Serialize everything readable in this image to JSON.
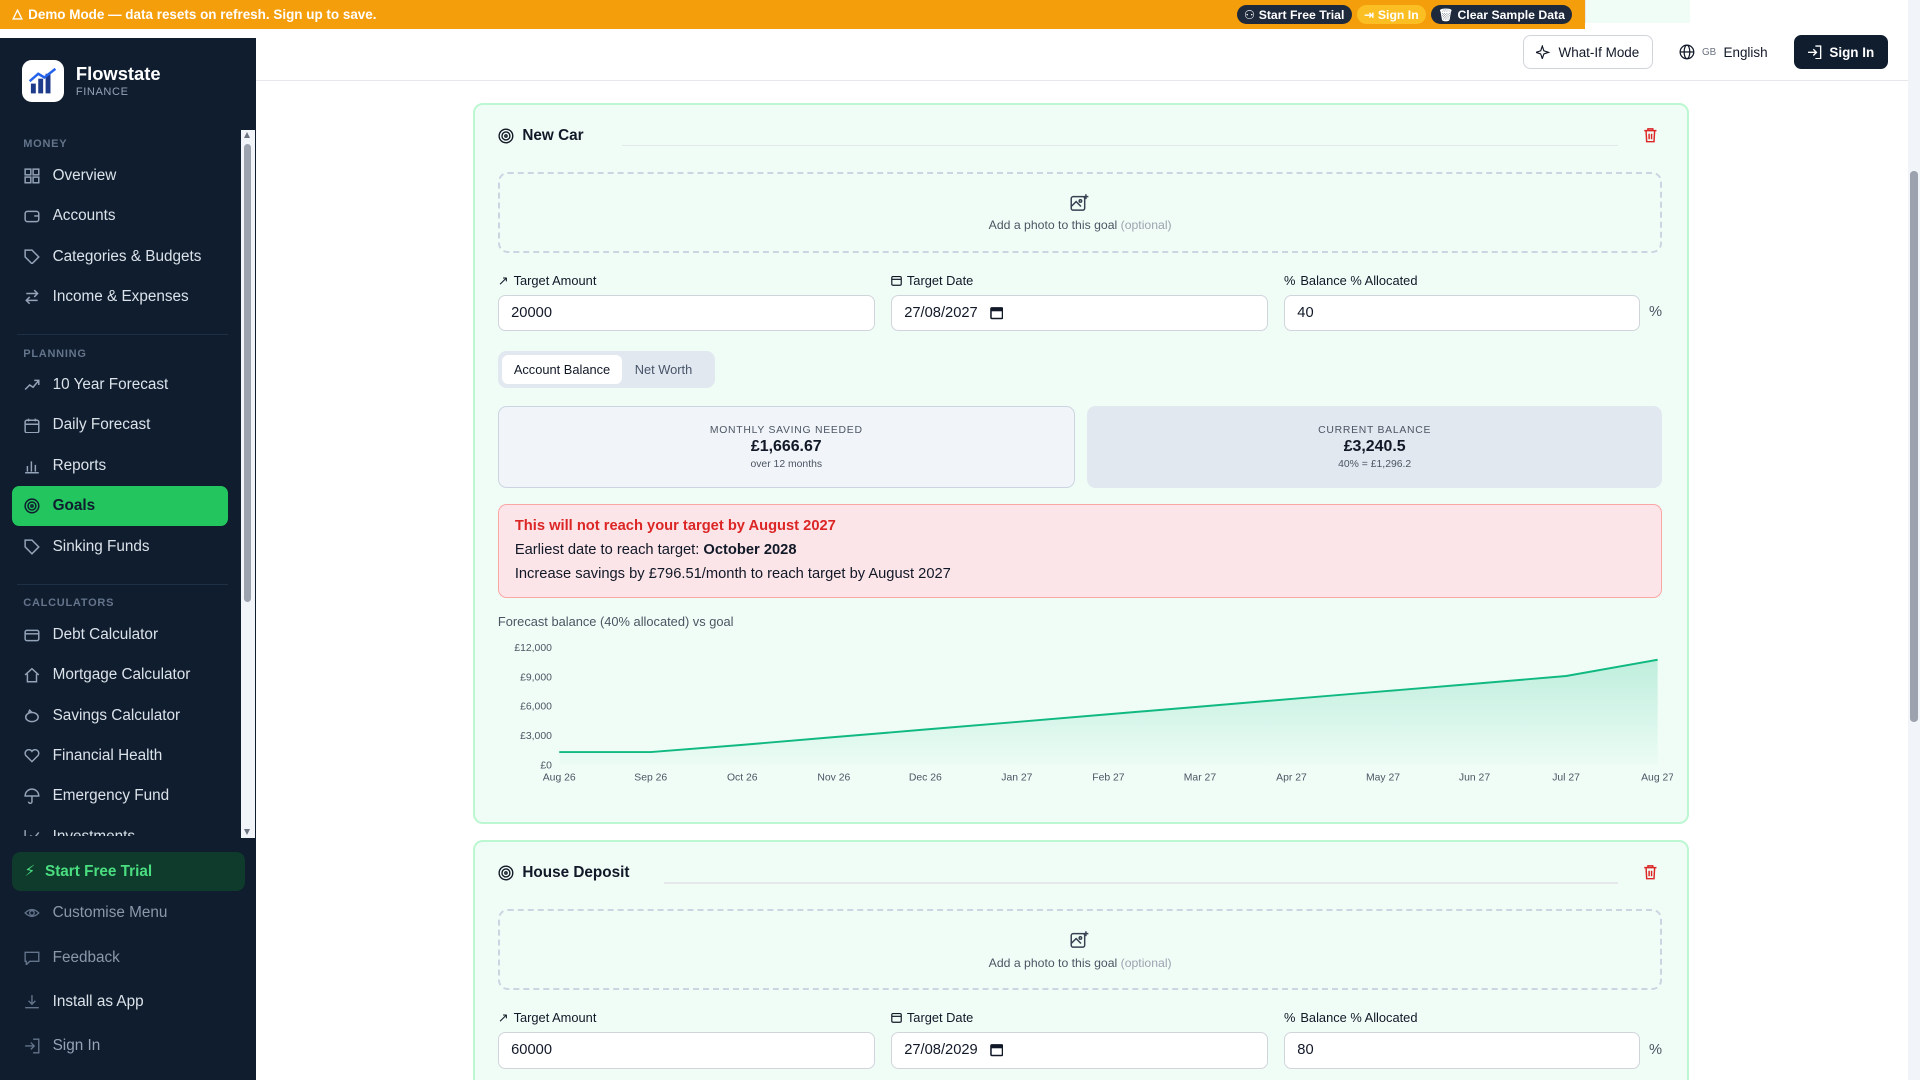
{
  "banner": {
    "message": "Demo Mode — data resets on refresh. Sign up to save.",
    "start_trial": "Start Free Trial",
    "sign_in": "Sign In",
    "clear": "Clear Sample Data"
  },
  "brand": {
    "name": "Flowstate",
    "sub": "FINANCE"
  },
  "sidebar": {
    "sections": [
      {
        "title": "MONEY",
        "items": [
          {
            "label": "Overview",
            "icon": "grid-icon"
          },
          {
            "label": "Accounts",
            "icon": "wallet-icon"
          },
          {
            "label": "Categories & Budgets",
            "icon": "tag-icon"
          },
          {
            "label": "Income & Expenses",
            "icon": "arrows-icon"
          }
        ]
      },
      {
        "title": "PLANNING",
        "items": [
          {
            "label": "10 Year Forecast",
            "icon": "trend-icon"
          },
          {
            "label": "Daily Forecast",
            "icon": "calendar-icon"
          },
          {
            "label": "Reports",
            "icon": "bar-chart-icon"
          },
          {
            "label": "Goals",
            "icon": "target-icon",
            "active": true
          },
          {
            "label": "Sinking Funds",
            "icon": "tag-icon"
          }
        ]
      },
      {
        "title": "CALCULATORS",
        "items": [
          {
            "label": "Debt Calculator",
            "icon": "card-icon"
          },
          {
            "label": "Mortgage Calculator",
            "icon": "house-icon"
          },
          {
            "label": "Savings Calculator",
            "icon": "piggy-icon"
          },
          {
            "label": "Financial Health",
            "icon": "heart-icon"
          },
          {
            "label": "Emergency Fund",
            "icon": "umbrella-icon"
          },
          {
            "label": "Investments",
            "icon": "line-chart-icon"
          }
        ]
      }
    ],
    "bottom": {
      "trial": "Start Free Trial",
      "customise": "Customise Menu",
      "feedback": "Feedback",
      "install": "Install as App",
      "sign_in": "Sign In"
    }
  },
  "topbar": {
    "whatif": "What-If Mode",
    "lang_code": "GB",
    "language": "English",
    "sign_in": "Sign In"
  },
  "goals": [
    {
      "name": "New Car",
      "photo_text": "Add a photo to this goal",
      "photo_optional": "(optional)",
      "target_amount_label": "Target Amount",
      "target_amount": "20000",
      "target_date_label": "Target Date",
      "target_date": "27/08/2027",
      "allocated_label": "Balance % Allocated",
      "allocated": "40",
      "pct": "%",
      "toggle": [
        "Account Balance",
        "Net Worth"
      ],
      "monthly_label": "MONTHLY SAVING NEEDED",
      "monthly_value": "£1,666.67",
      "monthly_sub": "over 12 months",
      "balance_label": "CURRENT BALANCE",
      "balance_value": "£3,240.5",
      "balance_sub": "40% = £1,296.2",
      "alert_title": "This will not reach your target by August 2027",
      "alert_earliest_prefix": "Earliest date to reach target:",
      "alert_earliest": "October 2028",
      "alert_increase": "Increase savings by £796.51/month to reach target by August 2027",
      "chart_title": "Forecast balance (40% allocated) vs goal"
    },
    {
      "name": "House Deposit",
      "photo_text": "Add a photo to this goal",
      "photo_optional": "(optional)",
      "target_amount_label": "Target Amount",
      "target_amount": "60000",
      "target_date_label": "Target Date",
      "target_date": "27/08/2029",
      "allocated_label": "Balance % Allocated",
      "allocated": "80",
      "pct": "%"
    }
  ],
  "chart_data": {
    "type": "area",
    "title": "Forecast balance (40% allocated) vs goal",
    "xlabel": "",
    "ylabel": "",
    "categories": [
      "Aug 26",
      "Sep 26",
      "Oct 26",
      "Nov 26",
      "Dec 26",
      "Jan 27",
      "Feb 27",
      "Mar 27",
      "Apr 27",
      "May 27",
      "Jun 27",
      "Jul 27",
      "Aug 27"
    ],
    "y_ticks": [
      "£0",
      "£3,000",
      "£6,000",
      "£9,000",
      "£12,000"
    ],
    "ylim": [
      0,
      12000
    ],
    "series": [
      {
        "values": [
          1296,
          1296,
          2040,
          2820,
          3600,
          4380,
          5160,
          5940,
          6720,
          7500,
          8280,
          9060,
          10720
        ]
      }
    ],
    "grid": false,
    "color": "#10b981"
  }
}
